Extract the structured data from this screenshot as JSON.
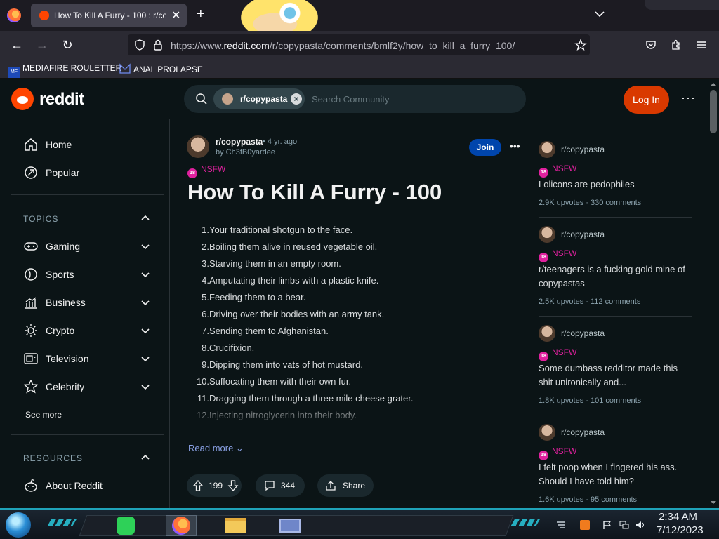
{
  "browser": {
    "tab_title": "How To Kill A Furry - 100 : r/copypasta",
    "url_prefix": "https://www.",
    "url_domain": "reddit.com",
    "url_path": "/r/copypasta/comments/bmlf2y/how_to_kill_a_furry_100/",
    "bookmarks": [
      "MEDIAFIRE ROULETTER",
      "ANAL PROLAPSE"
    ],
    "bookmark_icon_text": "MF"
  },
  "header": {
    "wordmark": "reddit",
    "search_chip": "r/copypasta",
    "search_placeholder": "Search Community",
    "login_label": "Log In",
    "more": "···"
  },
  "sidebar": {
    "main_items": [
      {
        "label": "Home",
        "icon": "home-icon"
      },
      {
        "label": "Popular",
        "icon": "popular-icon"
      }
    ],
    "topics_title": "TOPICS",
    "topics": [
      {
        "label": "Gaming",
        "icon": "gamepad-icon"
      },
      {
        "label": "Sports",
        "icon": "sports-icon"
      },
      {
        "label": "Business",
        "icon": "chart-icon"
      },
      {
        "label": "Crypto",
        "icon": "crypto-icon"
      },
      {
        "label": "Television",
        "icon": "tv-icon"
      },
      {
        "label": "Celebrity",
        "icon": "star-icon"
      }
    ],
    "see_more": "See more",
    "resources_title": "RESOURCES",
    "resources": [
      {
        "label": "About Reddit",
        "icon": "reddit-alien-icon"
      }
    ]
  },
  "post": {
    "subreddit": "r/copypasta",
    "age": "• 4 yr. ago",
    "author": "by Ch3fB0yardee",
    "join_label": "Join",
    "nsfw": "NSFW",
    "title": "How To Kill A Furry - 100",
    "items": [
      "Your traditional shotgun to the face.",
      "Boiling them alive in reused vegetable oil.",
      "Starving them in an empty room.",
      "Amputating their limbs with a plastic knife.",
      "Feeding them to a bear.",
      "Driving over their bodies with an army tank.",
      "Sending them to Afghanistan.",
      "Crucifixion.",
      "Dipping them into vats of hot mustard.",
      "Suffocating them with their own fur.",
      "Dragging them through a three mile cheese grater.",
      "Injecting nitroglycerin into their body."
    ],
    "read_more": "Read more",
    "votes": "199",
    "comments": "344",
    "share": "Share"
  },
  "related": [
    {
      "subreddit": "r/copypasta",
      "nsfw": "NSFW",
      "title": "Lolicons are pedophiles",
      "upvotes": "2.9K upvotes",
      "comments": "330 comments"
    },
    {
      "subreddit": "r/copypasta",
      "nsfw": "NSFW",
      "title": "r/teenagers is a fucking gold mine of copypastas",
      "upvotes": "2.5K upvotes",
      "comments": "112 comments"
    },
    {
      "subreddit": "r/copypasta",
      "nsfw": "NSFW",
      "title": "Some dumbass redditor made this shit unironically and...",
      "upvotes": "1.8K upvotes",
      "comments": "101 comments"
    },
    {
      "subreddit": "r/copypasta",
      "nsfw": "NSFW",
      "title": "I felt poop when I fingered his ass. Should I have told him?",
      "upvotes": "1.6K upvotes",
      "comments": "95 comments"
    }
  ],
  "taskbar": {
    "time": "2:34 AM",
    "date": "7/12/2023"
  },
  "colors": {
    "accent_orange": "#ff4500",
    "login_orange": "#d93900",
    "join_blue": "#0045ac",
    "nsfw_pink": "#e0219e"
  }
}
